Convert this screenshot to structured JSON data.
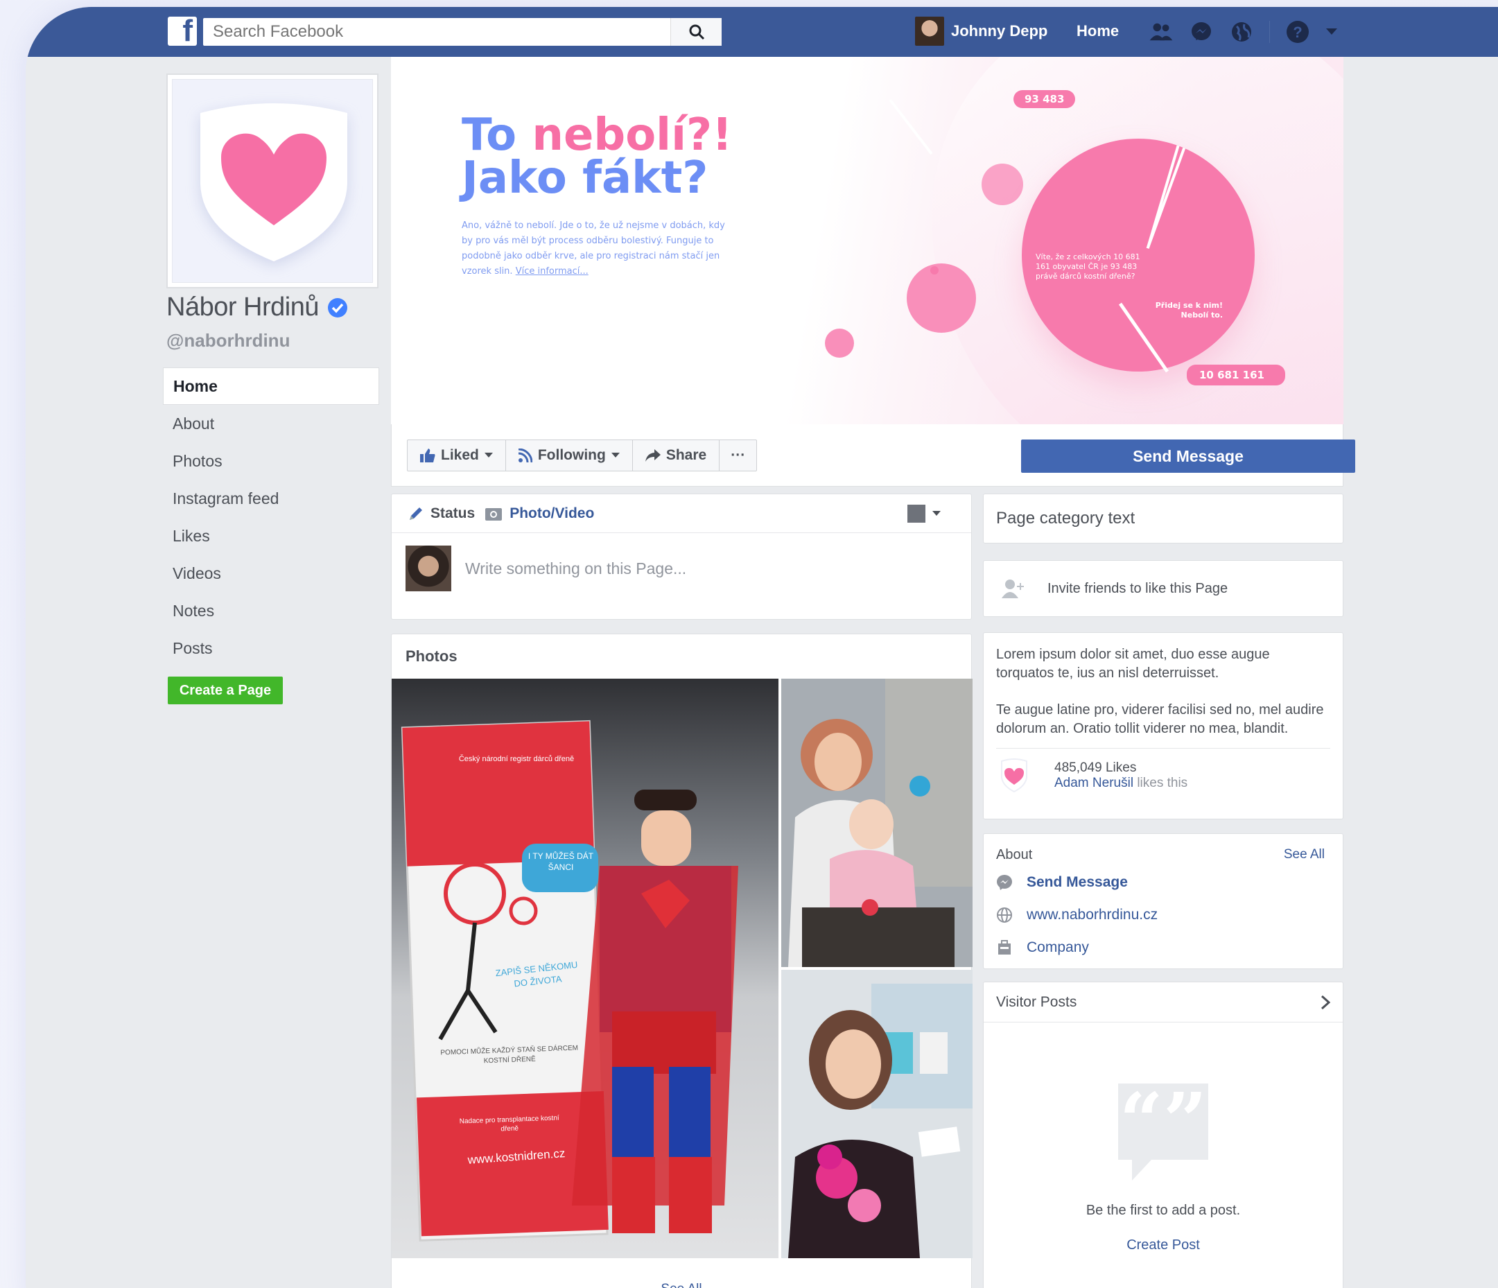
{
  "topbar": {
    "search_placeholder": "Search Facebook",
    "user_name": "Johnny Depp",
    "home_label": "Home",
    "brand_color": "#3b5998",
    "icons": [
      "friends-icon",
      "messenger-icon",
      "globe-icon",
      "help-icon",
      "caret-down-icon"
    ]
  },
  "page": {
    "name": "Nábor Hrdinů",
    "handle": "@naborhrdinu",
    "verified": true
  },
  "nav": {
    "items": [
      "Home",
      "About",
      "Photos",
      "Instagram feed",
      "Likes",
      "Videos",
      "Notes",
      "Posts"
    ],
    "active": "Home",
    "create_page": "Create a Page"
  },
  "cover": {
    "title_part1": "To ",
    "title_part2": "nebolí?!",
    "title_part3": " Jako fákt?",
    "text": "Ano, vážně to nebolí. Jde o to, že už nejsme v dobách, kdy by pro vás měl být process odběru bolestivý. Funguje to podobně jako odběr krve, ale pro registraci nám stačí jen vzorek slin.",
    "more_link": "Více informací...",
    "pie_text": "Víte, že z celkových 10 681 161 obyvatel ČR je 93 483 právě dárců kostní dřeně?",
    "pie_cta": "Přidej se k nim! Nebolí to.",
    "badge_top": "93 483",
    "badge_bottom": "10 681 161",
    "pie_share": 0.0088
  },
  "actions": {
    "liked": "Liked",
    "following": "Following",
    "share": "Share",
    "more": "···",
    "send_message": "Send Message"
  },
  "composer": {
    "status_tab": "Status",
    "photo_tab": "Photo/Video",
    "placeholder": "Write something on this Page..."
  },
  "photos": {
    "title": "Photos",
    "see_all": "See All",
    "banner_lines": [
      "Český národní registr dárců dřeně",
      "I TY MŮŽEŠ DÁT ŠANCI",
      "ZAPIŠ SE NĚKOMU DO ŽIVOTA",
      "POMOCI MŮŽE KAŽDÝ STAŇ SE DÁRCEM KOSTNÍ DŘENĚ",
      "Nadace pro transplantace kostní dřeně",
      "www.kostnidren.cz"
    ]
  },
  "sidebar": {
    "category": "Page category text",
    "invite": "Invite friends to like this Page",
    "desc_p1": "Lorem ipsum dolor sit amet, duo esse augue torquatos te, ius an nisl deterruisset.",
    "desc_p2": "Te augue latine pro, viderer facilisi sed no, mel audire dolorum an. Oratio tollit viderer no mea, blandit.",
    "likes_count": "485,049 Likes",
    "likes_friend": "Adam Nerušil",
    "likes_suffix": " likes this",
    "about_title": "About",
    "about_see_all": "See All",
    "about_send": "Send Message",
    "about_web": "www.naborhrdinu.cz",
    "about_company": "Company",
    "visitor_title": "Visitor Posts",
    "visitor_empty": "Be the first to add a post.",
    "create_post": "Create Post"
  }
}
